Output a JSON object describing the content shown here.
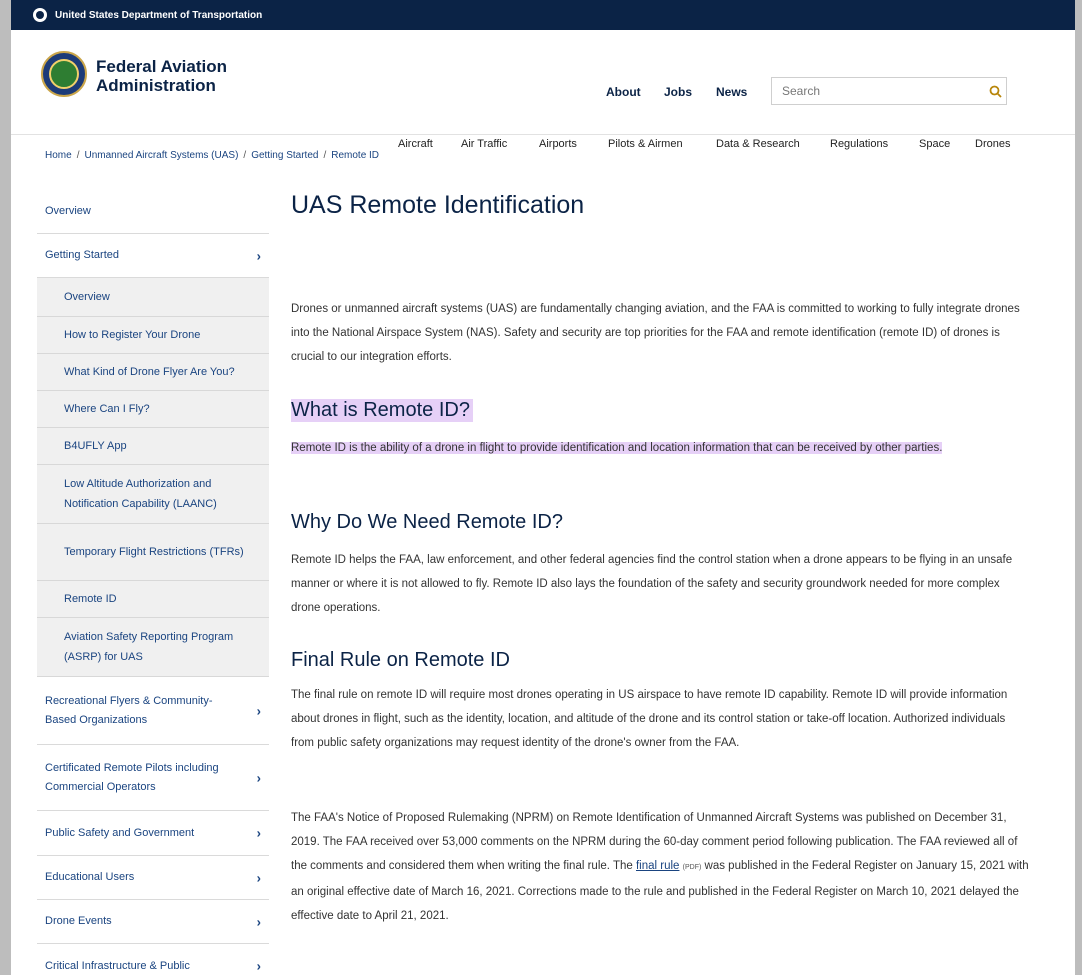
{
  "topbar": {
    "agency": "United States Department of Transportation"
  },
  "header": {
    "logo_line1": "Federal Aviation",
    "logo_line2": "Administration",
    "utility_nav": [
      "About",
      "Jobs",
      "News"
    ],
    "search_placeholder": "Search",
    "main_nav": [
      "Aircraft",
      "Air Traffic",
      "Airports",
      "Pilots & Airmen",
      "Data & Research",
      "Regulations",
      "Space",
      "Drones"
    ]
  },
  "breadcrumb": [
    "Home",
    "Unmanned Aircraft Systems (UAS)",
    "Getting Started",
    "Remote ID"
  ],
  "sidebar": {
    "overview": "Overview",
    "getting_started": "Getting Started",
    "sub_items": [
      "Overview",
      "How to Register Your Drone",
      "What Kind of Drone Flyer Are You?",
      "Where Can I Fly?",
      "B4UFLY App",
      "Low Altitude Authorization and Notification Capability (LAANC)",
      "Temporary Flight Restrictions (TFRs)",
      "Remote ID",
      "Aviation Safety Reporting Program (ASRP) for UAS"
    ],
    "sections": [
      "Recreational Flyers & Community-Based Organizations",
      "Certificated Remote Pilots including Commercial Operators",
      "Public Safety and Government",
      "Educational Users",
      "Drone Events",
      "Critical Infrastructure & Public"
    ]
  },
  "content": {
    "title": "UAS Remote Identification",
    "intro": "Drones or unmanned aircraft systems (UAS) are fundamentally changing aviation, and the FAA is committed to working to fully integrate drones into the National Airspace System (NAS). Safety and security are top priorities for the FAA and remote identification (remote ID) of drones is crucial to our integration efforts.",
    "what_heading": "What is Remote ID?",
    "what_text": "Remote ID is the ability of a drone in flight to provide identification and location information that can be received by other parties.",
    "why_heading": "Why Do We Need Remote ID?",
    "why_text": "Remote ID helps the FAA, law enforcement, and other federal agencies find the control station when a drone appears to be flying in an unsafe manner or where it is not allowed to fly. Remote ID also lays the foundation of the safety and security groundwork needed for more complex drone operations.",
    "final_heading": "Final Rule on Remote ID",
    "final_text": "The final rule on remote ID will require most drones operating in US airspace to have remote ID capability. Remote ID will provide information about drones in flight, such as the identity, location, and altitude of the drone and its control station or take-off location. Authorized individuals from public safety organizations may request identity of the drone's owner from the FAA.",
    "nprm_before": "The FAA's Notice of Proposed Rulemaking (NPRM) on Remote Identification of Unmanned Aircraft Systems was published on December 31, 2019. The FAA received over 53,000 comments on the NPRM during the 60-day comment period following publication. The FAA reviewed all of the comments and considered them when writing the final rule. The ",
    "nprm_link": "final rule",
    "nprm_pdf": "(PDF)",
    "nprm_after": " was published in the Federal Register on January 15, 2021 with an original effective date of March 16, 2021. Corrections made to the rule and published in the Federal Register on March 10, 2021 delayed the effective date to April 21, 2021."
  },
  "colors": {
    "navy": "#0b2346",
    "link": "#1a4480",
    "highlight": "#e6d0f7"
  }
}
